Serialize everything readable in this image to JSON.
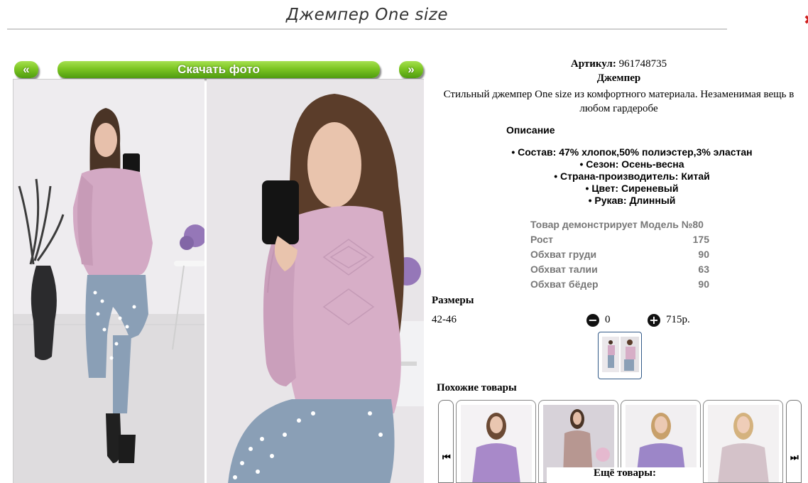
{
  "page": {
    "title": "Джемпер One size"
  },
  "gallery": {
    "prev_label": "«",
    "download_label": "Скачать фото",
    "next_label": "»"
  },
  "product": {
    "article_label": "Артикул:",
    "article_value": "961748735",
    "name": "Джемпер",
    "description": "Стильный джемпер One size из комфортного материала. Незаменимая вещь в любом гардеробе"
  },
  "specs": {
    "heading": "Описание",
    "items": [
      "• Состав: 47% хлопок,50% полиэстер,3% эластан",
      "• Сезон: Осень-весна",
      "• Страна-производитель: Китай",
      "• Цвет: Сиреневый",
      "• Рукав: Длинный"
    ]
  },
  "model": {
    "rows": [
      {
        "label": "Товар демонстрирует Модель №80",
        "value": ""
      },
      {
        "label": "Рост",
        "value": "175"
      },
      {
        "label": "Обхват груди",
        "value": "90"
      },
      {
        "label": "Обхват талии",
        "value": "63"
      },
      {
        "label": "Обхват бёдер",
        "value": "90"
      }
    ]
  },
  "sizes": {
    "heading": "Размеры",
    "size": "42-46",
    "minus_icon": "−",
    "quantity": "0",
    "plus_icon": "+",
    "price": "715р."
  },
  "similar": {
    "heading": "Похожие товары",
    "prev_icon": "⏮",
    "next_icon": "⏭",
    "more_label": "Ещё товары:",
    "cards": [
      {
        "sweater_color": "#a889c9",
        "bg_color": "#f4f2f4"
      },
      {
        "sweater_color": "#b79791",
        "bg_color": "#d7d2d9"
      },
      {
        "sweater_color": "#9c86c8",
        "bg_color": "#f1eff1"
      },
      {
        "sweater_color": "#d4c2c9",
        "bg_color": "#f3f1f2"
      }
    ]
  },
  "colors": {
    "button_green": "#7cc522",
    "sweater_pink": "#d3a9c4",
    "jeans_blue": "#8a9fb6"
  },
  "icons": {
    "close": "close-icon",
    "minus": "minus-circle-icon",
    "plus": "plus-circle-icon",
    "prev": "skip-back-icon",
    "next": "skip-forward-icon"
  }
}
